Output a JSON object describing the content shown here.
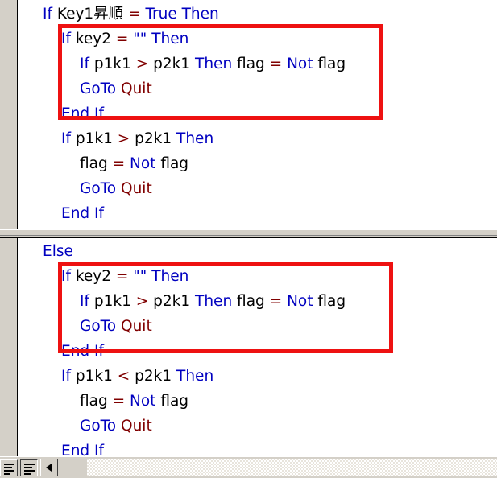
{
  "editor": {
    "top_pane": {
      "lines": [
        {
          "indent": 30,
          "tokens": [
            {
              "t": "If ",
              "c": "kw"
            },
            {
              "t": "Key1昇順 ",
              "c": "id"
            },
            {
              "t": "= ",
              "c": "op"
            },
            {
              "t": "True Then",
              "c": "kw"
            }
          ]
        },
        {
          "indent": 53,
          "tokens": [
            {
              "t": "If ",
              "c": "kw"
            },
            {
              "t": "key2 ",
              "c": "id"
            },
            {
              "t": "= ",
              "c": "op"
            },
            {
              "t": "\"\" ",
              "c": "kw"
            },
            {
              "t": "Then",
              "c": "kw"
            }
          ]
        },
        {
          "indent": 76,
          "tokens": [
            {
              "t": "If ",
              "c": "kw"
            },
            {
              "t": "p1k1 ",
              "c": "id"
            },
            {
              "t": "> ",
              "c": "op"
            },
            {
              "t": "p2k1 ",
              "c": "id"
            },
            {
              "t": "Then ",
              "c": "kw"
            },
            {
              "t": "flag ",
              "c": "id"
            },
            {
              "t": "= ",
              "c": "op"
            },
            {
              "t": "Not ",
              "c": "kw"
            },
            {
              "t": "flag",
              "c": "id"
            }
          ]
        },
        {
          "indent": 76,
          "tokens": [
            {
              "t": "GoTo ",
              "c": "kw"
            },
            {
              "t": "Quit",
              "c": "lbl"
            }
          ]
        },
        {
          "indent": 53,
          "tokens": [
            {
              "t": "End If",
              "c": "kw"
            }
          ]
        },
        {
          "indent": 53,
          "tokens": [
            {
              "t": "If ",
              "c": "kw"
            },
            {
              "t": "p1k1 ",
              "c": "id"
            },
            {
              "t": "> ",
              "c": "op"
            },
            {
              "t": "p2k1 ",
              "c": "id"
            },
            {
              "t": "Then",
              "c": "kw"
            }
          ]
        },
        {
          "indent": 76,
          "tokens": [
            {
              "t": "flag ",
              "c": "id"
            },
            {
              "t": "= ",
              "c": "op"
            },
            {
              "t": "Not ",
              "c": "kw"
            },
            {
              "t": "flag",
              "c": "id"
            }
          ]
        },
        {
          "indent": 76,
          "tokens": [
            {
              "t": "GoTo ",
              "c": "kw"
            },
            {
              "t": "Quit",
              "c": "lbl"
            }
          ]
        },
        {
          "indent": 53,
          "tokens": [
            {
              "t": "End If",
              "c": "kw"
            }
          ]
        }
      ]
    },
    "bottom_pane": {
      "lines": [
        {
          "indent": 30,
          "tokens": [
            {
              "t": "Else",
              "c": "kw"
            }
          ]
        },
        {
          "indent": 53,
          "tokens": [
            {
              "t": "If ",
              "c": "kw"
            },
            {
              "t": "key2 ",
              "c": "id"
            },
            {
              "t": "= ",
              "c": "op"
            },
            {
              "t": "\"\" ",
              "c": "kw"
            },
            {
              "t": "Then",
              "c": "kw"
            }
          ]
        },
        {
          "indent": 76,
          "tokens": [
            {
              "t": "If ",
              "c": "kw"
            },
            {
              "t": "p1k1 ",
              "c": "id"
            },
            {
              "t": "> ",
              "c": "op"
            },
            {
              "t": "p2k1 ",
              "c": "id"
            },
            {
              "t": "Then ",
              "c": "kw"
            },
            {
              "t": "flag ",
              "c": "id"
            },
            {
              "t": "= ",
              "c": "op"
            },
            {
              "t": "Not ",
              "c": "kw"
            },
            {
              "t": "flag",
              "c": "id"
            }
          ]
        },
        {
          "indent": 76,
          "tokens": [
            {
              "t": "GoTo ",
              "c": "kw"
            },
            {
              "t": "Quit",
              "c": "lbl"
            }
          ]
        },
        {
          "indent": 53,
          "tokens": [
            {
              "t": "End If",
              "c": "kw"
            }
          ]
        },
        {
          "indent": 53,
          "tokens": [
            {
              "t": "If ",
              "c": "kw"
            },
            {
              "t": "p1k1 ",
              "c": "id"
            },
            {
              "t": "< ",
              "c": "op"
            },
            {
              "t": "p2k1 ",
              "c": "id"
            },
            {
              "t": "Then",
              "c": "kw"
            }
          ]
        },
        {
          "indent": 76,
          "tokens": [
            {
              "t": "flag ",
              "c": "id"
            },
            {
              "t": "= ",
              "c": "op"
            },
            {
              "t": "Not ",
              "c": "kw"
            },
            {
              "t": "flag",
              "c": "id"
            }
          ]
        },
        {
          "indent": 76,
          "tokens": [
            {
              "t": "GoTo ",
              "c": "kw"
            },
            {
              "t": "Quit",
              "c": "lbl"
            }
          ]
        },
        {
          "indent": 53,
          "tokens": [
            {
              "t": "End If",
              "c": "kw"
            }
          ]
        }
      ]
    }
  },
  "annotations": {
    "highlight_boxes": [
      {
        "name": "top-highlight-box",
        "color": "#ee1111"
      },
      {
        "name": "bottom-highlight-box",
        "color": "#ee1111"
      }
    ]
  },
  "colors": {
    "keyword": "#0000c0",
    "identifier": "#000000",
    "label": "#800000",
    "operator": "#800000",
    "annotation": "#ee1111",
    "chrome": "#d4d0c8"
  },
  "bottom_bar": {
    "procedure_view_button": "procedure-view",
    "full_module_view_button": "full-module-view",
    "scroll_left_arrow": "◀"
  }
}
